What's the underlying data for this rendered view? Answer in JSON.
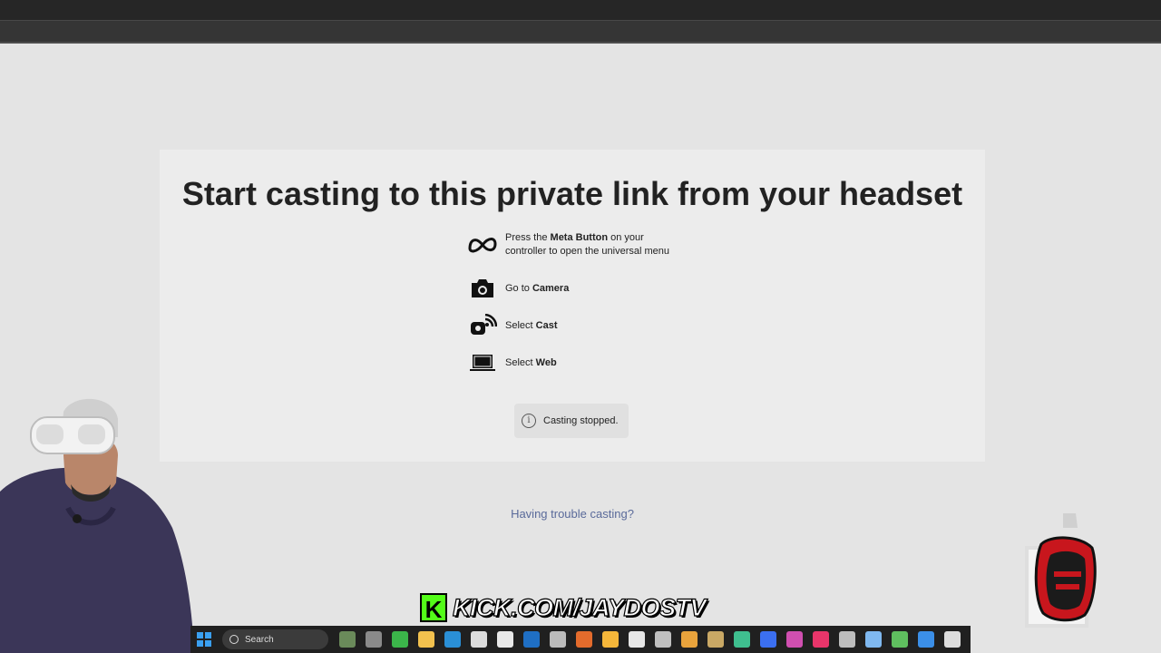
{
  "page": {
    "heading": "Start casting to this private link from your headset",
    "trouble_link": "Having trouble casting?"
  },
  "steps": [
    {
      "icon": "meta-logo-icon",
      "pre": "Press the ",
      "bold": "Meta Button",
      "post": " on your",
      "line2": "controller to open the universal menu"
    },
    {
      "icon": "camera-icon",
      "pre": "Go to ",
      "bold": "Camera",
      "post": ""
    },
    {
      "icon": "cast-icon",
      "pre": "Select ",
      "bold": "Cast",
      "post": ""
    },
    {
      "icon": "laptop-icon",
      "pre": "Select ",
      "bold": "Web",
      "post": ""
    }
  ],
  "status": {
    "icon": "info-icon",
    "glyph": "i",
    "message": "Casting stopped."
  },
  "overlay": {
    "kick_letter": "K",
    "kick_url": "KICK.COM/JAYDOSTV"
  },
  "taskbar": {
    "search_label": "Search",
    "apps": [
      {
        "icon": "widgets-icon",
        "color": "#6a8a5a"
      },
      {
        "icon": "task-view-icon",
        "color": "#8a8a8a"
      },
      {
        "icon": "play-icon",
        "color": "#3bb54a"
      },
      {
        "icon": "file-explorer-icon",
        "color": "#f2c14e"
      },
      {
        "icon": "edge-icon",
        "color": "#2a8fd6"
      },
      {
        "icon": "store-icon",
        "color": "#dcdcdc"
      },
      {
        "icon": "file-icon",
        "color": "#e8e8e8"
      },
      {
        "icon": "outlook-icon",
        "color": "#1f6fc4"
      },
      {
        "icon": "app-icon",
        "color": "#bbbbbb"
      },
      {
        "icon": "affinity-icon",
        "color": "#e36b2c"
      },
      {
        "icon": "app-icon",
        "color": "#f4b63a"
      },
      {
        "icon": "unreal-icon",
        "color": "#e6e6e6"
      },
      {
        "icon": "app-icon",
        "color": "#bfbfbf"
      },
      {
        "icon": "chrome-icon",
        "color": "#e8a33c"
      },
      {
        "icon": "app-icon",
        "color": "#c9a865"
      },
      {
        "icon": "chat-icon",
        "color": "#3fbf8f"
      },
      {
        "icon": "zoom-icon",
        "color": "#3b6ff0"
      },
      {
        "icon": "app-icon",
        "color": "#d04fb0"
      },
      {
        "icon": "tiktok-icon",
        "color": "#e8356a"
      },
      {
        "icon": "app-icon",
        "color": "#bdbdbd"
      },
      {
        "icon": "vpn-icon",
        "color": "#7fb8f0"
      },
      {
        "icon": "app-icon",
        "color": "#5fbf5f"
      },
      {
        "icon": "app-icon",
        "color": "#3b8fe8"
      },
      {
        "icon": "app-icon",
        "color": "#dddddd"
      }
    ]
  },
  "colors": {
    "background": "#e4e4e4",
    "card": "#ececec",
    "link": "#5a6a9a",
    "kick_green": "#53fc18"
  }
}
